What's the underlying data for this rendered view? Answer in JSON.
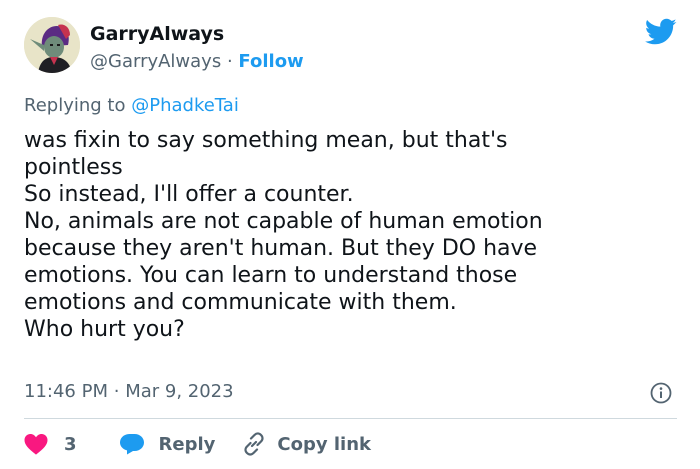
{
  "author": {
    "display_name": "GarryAlways",
    "handle": "@GarryAlways",
    "separator": "·",
    "follow_label": "Follow"
  },
  "reply_context": {
    "prefix": "Replying to",
    "mention": "@PhadkeTai"
  },
  "tweet": {
    "lines": [
      "was fixin to say something mean, but that's",
      "pointless",
      "So instead, I'll offer a counter.",
      "No, animals are not capable of human emotion",
      "because they aren't human. But they DO have",
      "emotions. You can learn to understand those",
      "emotions and communicate with them.",
      "Who hurt you?"
    ]
  },
  "meta": {
    "time": "11:46 PM",
    "separator": "·",
    "date": "Mar 9, 2023"
  },
  "actions": {
    "like_count": "3",
    "reply_label": "Reply",
    "copy_link_label": "Copy link"
  },
  "colors": {
    "brand_blue": "#1d9bf0",
    "like_red": "#f91880",
    "muted_text": "#536471",
    "divider": "#cfd9de"
  },
  "icons": [
    "twitter-bird-icon",
    "info-icon",
    "heart-icon",
    "reply-bubble-icon",
    "link-icon"
  ]
}
